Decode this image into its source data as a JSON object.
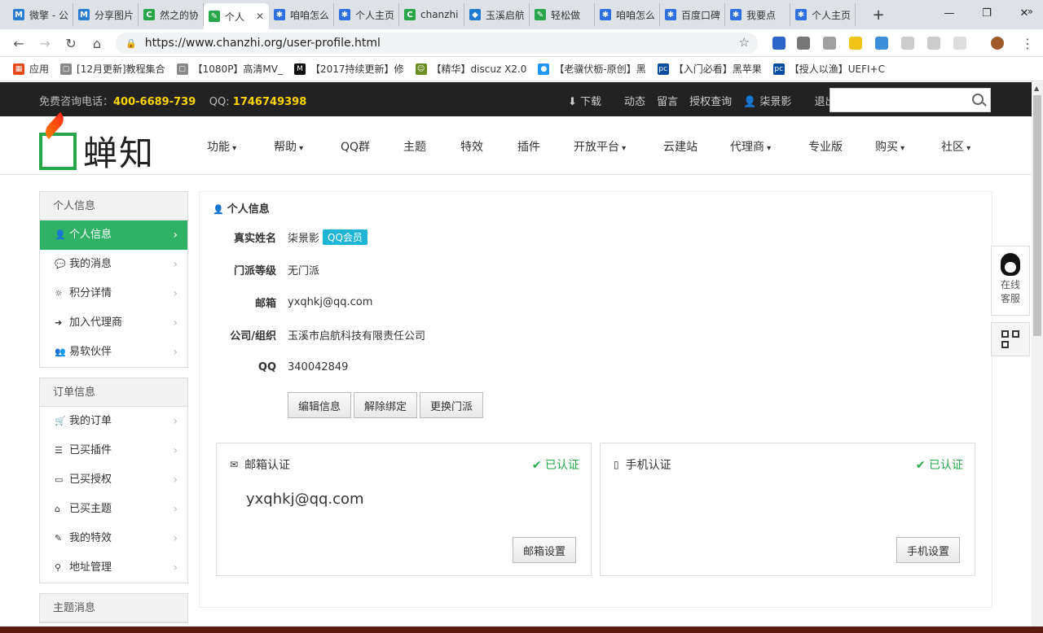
{
  "browser": {
    "tabs": [
      {
        "title": "微擎 - 公",
        "fav": "M",
        "color": "#2b7cd3"
      },
      {
        "title": "分享图片",
        "fav": "M",
        "color": "#2b7cd3"
      },
      {
        "title": "然之的协",
        "fav": "C",
        "color": "#27a64a"
      },
      {
        "title": "个人",
        "fav": "✎",
        "color": "#27a64a"
      },
      {
        "title": "咱咱怎么",
        "fav": "✱",
        "color": "#2f6fe0"
      },
      {
        "title": "个人主页",
        "fav": "✱",
        "color": "#2f6fe0"
      },
      {
        "title": "chanzhi",
        "fav": "C",
        "color": "#27a64a"
      },
      {
        "title": "玉溪启航",
        "fav": "◆",
        "color": "#1e7bd1"
      },
      {
        "title": "轻松做",
        "fav": "✎",
        "color": "#27a64a"
      },
      {
        "title": "咱咱怎么",
        "fav": "✱",
        "color": "#2f6fe0"
      },
      {
        "title": "百度口碑",
        "fav": "✱",
        "color": "#2f6fe0"
      },
      {
        "title": "我要点",
        "fav": "✱",
        "color": "#2f6fe0"
      },
      {
        "title": "个人主页",
        "fav": "✱",
        "color": "#2f6fe0"
      }
    ],
    "active_tab_index": 3,
    "url": "https://www.chanzhi.org/user-profile.html",
    "bookmarks": [
      {
        "label": "应用",
        "icon": "grid"
      },
      {
        "label": "[12月更新]教程集合",
        "icon": "page"
      },
      {
        "label": "【1080P】高清MV_",
        "icon": "page"
      },
      {
        "label": "【2017持续更新】修",
        "icon": "M"
      },
      {
        "label": "【精华】discuz X2.0",
        "icon": "face"
      },
      {
        "label": "【老骥伏枥-原创】黑",
        "icon": "chat"
      },
      {
        "label": "【入门必看】黑苹果",
        "icon": "pc"
      },
      {
        "label": "【授人以渔】UEFI+C",
        "icon": "pc"
      }
    ]
  },
  "site": {
    "hotline_label": "免费咨询电话：",
    "hotline": "400-6689-739",
    "qq_label": "QQ:",
    "qq": "1746749398",
    "top_links": [
      "下载",
      "动态",
      "留言",
      "授权查询",
      "柒景影",
      "退出"
    ],
    "logo_text": "蝉知",
    "nav": [
      {
        "label": "功能",
        "dropdown": true
      },
      {
        "label": "帮助",
        "dropdown": true
      },
      {
        "label": "QQ群",
        "dropdown": false
      },
      {
        "label": "主题",
        "dropdown": false
      },
      {
        "label": "特效",
        "dropdown": false
      },
      {
        "label": "插件",
        "dropdown": false
      },
      {
        "label": "开放平台",
        "dropdown": true
      },
      {
        "label": "云建站",
        "dropdown": false
      },
      {
        "label": "代理商",
        "dropdown": true
      },
      {
        "label": "专业版",
        "dropdown": false
      },
      {
        "label": "购买",
        "dropdown": true
      },
      {
        "label": "社区",
        "dropdown": true
      }
    ]
  },
  "sidebar": {
    "groups": [
      {
        "title": "个人信息",
        "items": [
          {
            "label": "个人信息",
            "icon": "user-icon",
            "active": true
          },
          {
            "label": "我的消息",
            "icon": "comments-icon"
          },
          {
            "label": "积分详情",
            "icon": "sun-icon"
          },
          {
            "label": "加入代理商",
            "icon": "sign-in-icon"
          },
          {
            "label": "易软伙伴",
            "icon": "group-icon"
          }
        ]
      },
      {
        "title": "订单信息",
        "items": [
          {
            "label": "我的订单",
            "icon": "cart-icon"
          },
          {
            "label": "已买插件",
            "icon": "list-icon"
          },
          {
            "label": "已买授权",
            "icon": "credit-card-icon"
          },
          {
            "label": "已买主题",
            "icon": "inbox-icon"
          },
          {
            "label": "我的特效",
            "icon": "magic-icon"
          },
          {
            "label": "地址管理",
            "icon": "map-marker-icon"
          }
        ]
      },
      {
        "title": "主题消息",
        "items": []
      }
    ]
  },
  "profile": {
    "title": "个人信息",
    "fields": [
      {
        "label": "真实姓名",
        "value": "柒景影",
        "badge": "QQ会员"
      },
      {
        "label": "门派等级",
        "value": "无门派"
      },
      {
        "label": "邮箱",
        "value": "yxqhkj@qq.com"
      },
      {
        "label": "公司/组织",
        "value": "玉溪市启航科技有限责任公司"
      },
      {
        "label": "QQ",
        "value": "340042849"
      }
    ],
    "buttons": [
      "编辑信息",
      "解除绑定",
      "更换门派"
    ]
  },
  "cards": {
    "email": {
      "title": "邮箱认证",
      "status": "已认证",
      "value": "yxqhkj@qq.com",
      "button": "邮箱设置"
    },
    "phone": {
      "title": "手机认证",
      "status": "已认证",
      "button": "手机设置"
    }
  },
  "service": {
    "label1": "在线",
    "label2": "客服"
  },
  "colors": {
    "brand_green": "#2fb166",
    "top_bar": "#222222",
    "hotline_yellow": "#ffd500",
    "verified_green": "#27a64a",
    "badge_cyan": "#1fb6d6"
  }
}
